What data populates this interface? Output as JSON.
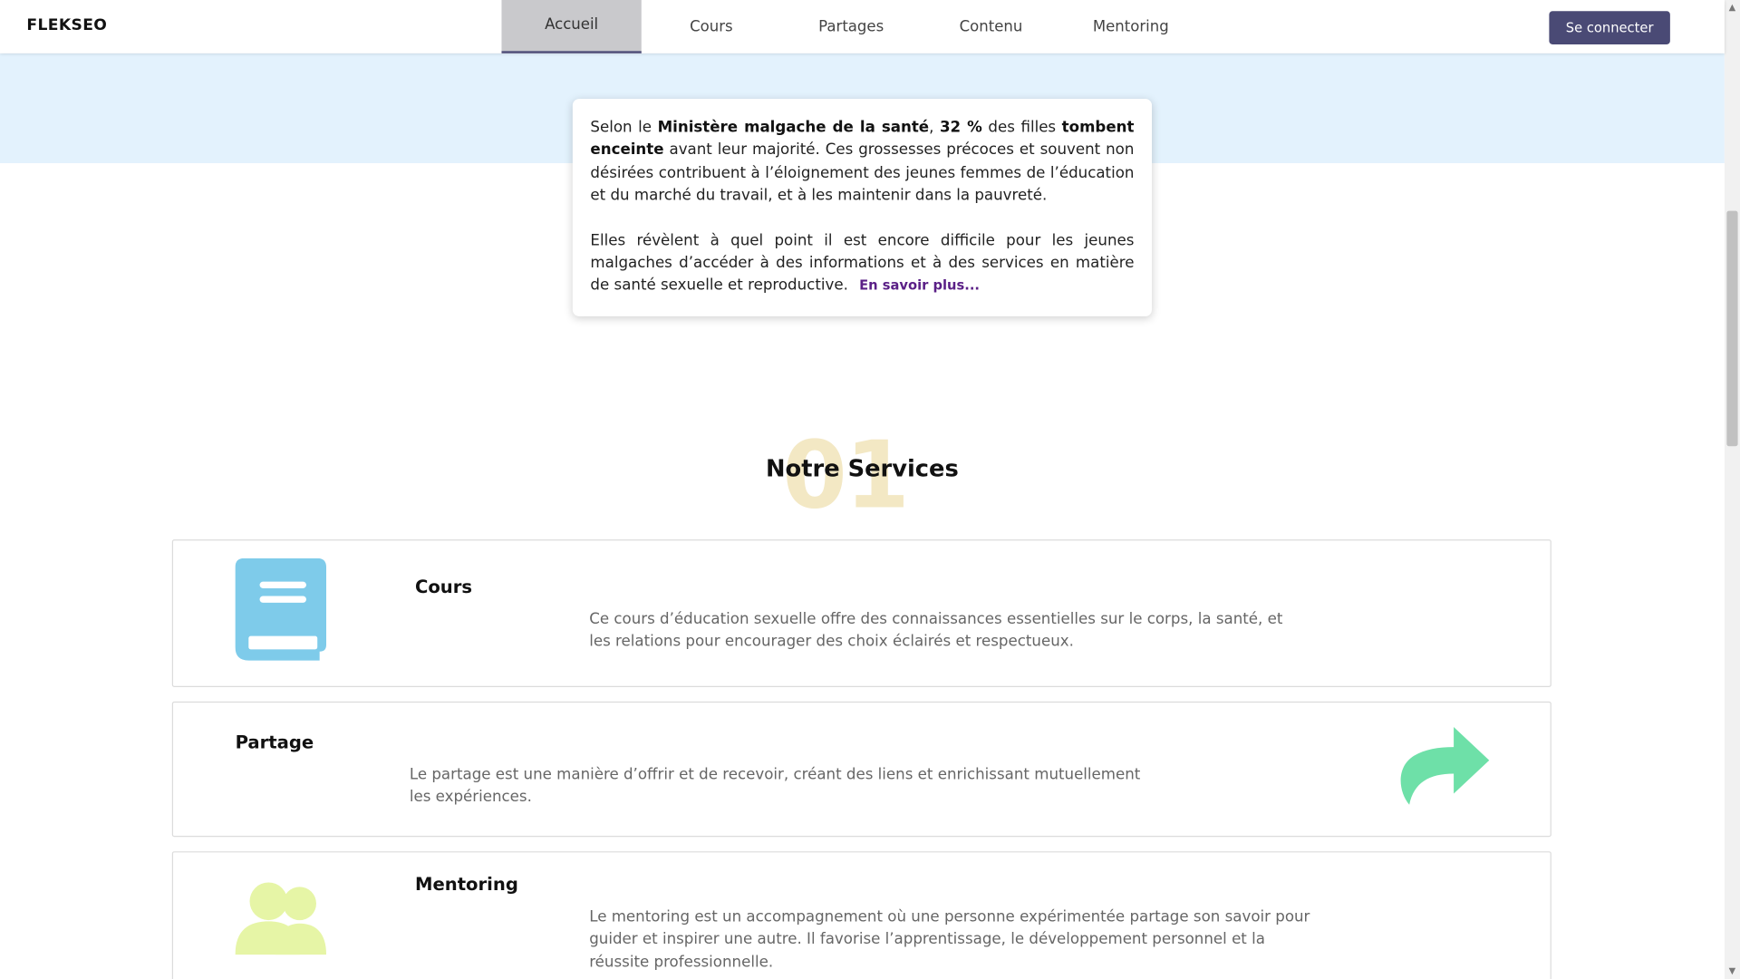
{
  "header": {
    "brand": "FLEKSEO",
    "nav": [
      {
        "label": "Accueil",
        "active": true
      },
      {
        "label": "Cours",
        "active": false
      },
      {
        "label": "Partages",
        "active": false
      },
      {
        "label": "Contenu",
        "active": false
      },
      {
        "label": "Mentoring",
        "active": false
      }
    ],
    "login_label": "Se connecter"
  },
  "intro": {
    "p1": {
      "t1": "Selon le ",
      "b1": "Ministère malgache de la santé",
      "t2": ", ",
      "b2": "32 %",
      "t3": " des filles ",
      "b3": "tombent enceinte",
      "t4": " avant leur majorité. Ces grossesses précoces et souvent non désirées contribuent à l’éloignement des jeunes femmes de l’éducation et du marché du travail, et à les maintenir dans la pauvreté."
    },
    "p2": "Elles révèlent à quel point il est encore difficile pour les jeunes malgaches d’accéder à des informations et à des services en matière de santé sexuelle et reproductive.",
    "read_more": "En savoir plus..."
  },
  "services": {
    "number": "01",
    "title": "Notre Services",
    "items": [
      {
        "title": "Cours",
        "description": "Ce cours d’éducation sexuelle offre des connaissances essentielles sur le corps, la santé, et les relations pour encourager des choix éclairés et respectueux.",
        "icon": "book-icon",
        "color": "#7ecbea"
      },
      {
        "title": "Partage",
        "description": "Le partage est une manière d’offrir et de recevoir, créant des liens et enrichissant mutuellement les expériences.",
        "icon": "share-icon",
        "color": "#6ee0a8"
      },
      {
        "title": "Mentoring",
        "description": "Le mentoring est un accompagnement où une personne expérimentée partage son savoir pour guider et inspirer une autre. Il favorise l’apprentissage, le développement personnel et la réussite professionnelle.",
        "icon": "users-icon",
        "color": "#e6f5a6"
      }
    ]
  },
  "colors": {
    "accent": "#4a4a75",
    "hero_band": "#e3f2fd",
    "link": "#5a1f86"
  }
}
